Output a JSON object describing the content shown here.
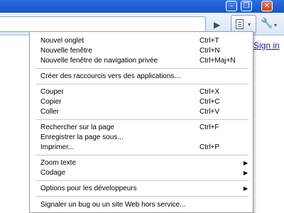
{
  "window": {
    "minimize_glyph": "–",
    "restore_glyph": "❐",
    "close_glyph": "✕"
  },
  "toolbar": {
    "go_glyph": "▶",
    "caret_glyph": "▾",
    "signin_link": "Sign in",
    "icons": [
      "play-icon",
      "page-icon",
      "wrench-icon"
    ]
  },
  "menu": {
    "arrow_glyph": "▶",
    "items": [
      {
        "label": "Nouvel onglet",
        "shortcut": "Ctrl+T"
      },
      {
        "label": "Nouvelle fenêtre",
        "shortcut": "Ctrl+N"
      },
      {
        "label": "Nouvelle fenêtre de navigation privée",
        "shortcut": "Ctrl+Maj+N"
      },
      {
        "label": "Créer des raccourcis vers des applications..."
      },
      {
        "label": "Couper",
        "shortcut": "Ctrl+X"
      },
      {
        "label": "Copier",
        "shortcut": "Ctrl+C"
      },
      {
        "label": "Coller",
        "shortcut": "Ctrl+V"
      },
      {
        "label": "Rechercher sur la page",
        "shortcut": "Ctrl+F"
      },
      {
        "label": "Enregistrer la page sous..."
      },
      {
        "label": "Imprimer...",
        "shortcut": "Ctrl+P"
      },
      {
        "label": "Zoom texte"
      },
      {
        "label": "Codage"
      },
      {
        "label": "Options pour les développeurs"
      },
      {
        "label": "Signaler un bug ou un site Web hors service..."
      }
    ]
  }
}
